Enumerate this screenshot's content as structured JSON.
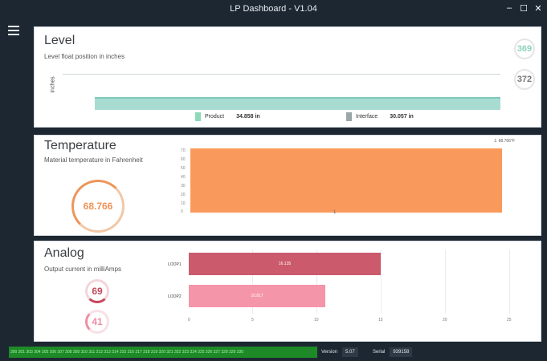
{
  "window": {
    "title": "LP Dashboard - V1.04",
    "min": "–",
    "max": "☐",
    "close": "✕"
  },
  "level": {
    "title": "Level",
    "subtitle": "Level float position in inches",
    "axis_label": "inches",
    "gauges": [
      "369",
      "372"
    ],
    "legend": [
      {
        "name": "Product",
        "value": "34.858 in",
        "color": "#8ed9b9"
      },
      {
        "name": "Interface",
        "value": "30.057 in",
        "color": "#9aa6a8"
      }
    ]
  },
  "temperature": {
    "title": "Temperature",
    "subtitle": "Material temperature in Fahrenheit",
    "gauge": "68.766",
    "legend": "1: 68.766°F",
    "yticks": [
      "70",
      "60",
      "50",
      "40",
      "30",
      "20",
      "10",
      "0"
    ],
    "xlabel": "1"
  },
  "analog": {
    "title": "Analog",
    "subtitle": "Output current in milliAmps",
    "gauges": [
      "69",
      "41"
    ],
    "bars": [
      {
        "name": "LOOP1",
        "value": "16.135",
        "fraction": 0.83
      },
      {
        "name": "LOOP2",
        "value": "10.817",
        "fraction": 0.56
      }
    ],
    "xticks": [
      "0",
      "5",
      "10",
      "15",
      "20",
      "25"
    ]
  },
  "status": {
    "registers": "300 301 303 304 305 306 307 308 309 310 311 312 313 314 315 316 317 318 319 320 321 322 323 324 325 326 327 328 329 330",
    "version_label": "Version",
    "version": "5.07",
    "serial_label": "Serial",
    "serial": "939158"
  }
}
